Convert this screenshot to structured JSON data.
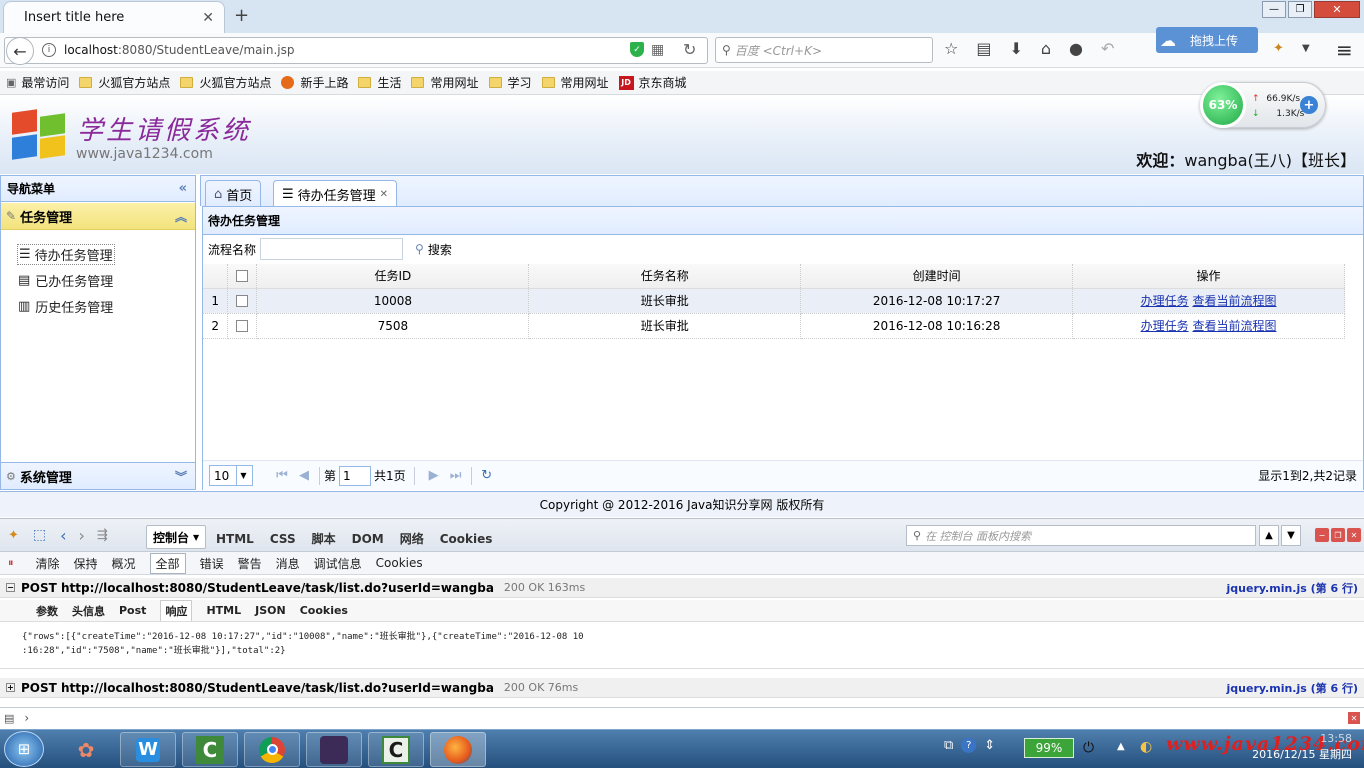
{
  "browser": {
    "tab_title": "Insert title here",
    "url_host": "localhost",
    "url_rest": ":8080/StudentLeave/main.jsp",
    "search_placeholder": "百度 <Ctrl+K>",
    "upload_label": "拖拽上传",
    "bookmarks": [
      "最常访问",
      "火狐官方站点",
      "火狐官方站点",
      "新手上路",
      "生活",
      "常用网址",
      "学习",
      "常用网址",
      "京东商城"
    ]
  },
  "net_widget": {
    "percent": "63%",
    "up": "66.9K/s",
    "down": "1.3K/s"
  },
  "app": {
    "name": "学生请假系统",
    "site": "www.java1234.com",
    "welcome_label": "欢迎：",
    "welcome_user": "wangba(王八)【班长】"
  },
  "sidebar": {
    "title": "导航菜单",
    "section": "任务管理",
    "items": [
      "待办任务管理",
      "已办任务管理",
      "历史任务管理"
    ],
    "system": "系统管理"
  },
  "tabs": {
    "home": "首页",
    "active": "待办任务管理"
  },
  "panel": {
    "title": "待办任务管理",
    "filter_label": "流程名称",
    "search_button": "搜索",
    "columns": [
      "任务ID",
      "任务名称",
      "创建时间",
      "操作"
    ],
    "rows": [
      {
        "num": "1",
        "id": "10008",
        "name": "班长审批",
        "time": "2016-12-08 10:17:27",
        "action1": "办理任务",
        "action2": "查看当前流程图"
      },
      {
        "num": "2",
        "id": "7508",
        "name": "班长审批",
        "time": "2016-12-08 10:16:28",
        "action1": "办理任务",
        "action2": "查看当前流程图"
      }
    ],
    "pager": {
      "page_size": "10",
      "page_prefix": "第",
      "page": "1",
      "page_total": "共1页",
      "summary": "显示1到2,共2记录"
    }
  },
  "copyright": "Copyright @ 2012-2016 Java知识分享网 版权所有",
  "firebug": {
    "tabs": [
      "控制台",
      "HTML",
      "CSS",
      "脚本",
      "DOM",
      "网络",
      "Cookies"
    ],
    "search_placeholder": "在 控制台 面板内搜索",
    "sub": [
      "清除",
      "保持",
      "概况",
      "全部",
      "错误",
      "警告",
      "消息",
      "调试信息",
      "Cookies"
    ],
    "requests": [
      {
        "text": "POST http://localhost:8080/StudentLeave/task/list.do?userId=wangba",
        "status": "200 OK 163ms",
        "source": "jquery.min.js (第 6 行)"
      },
      {
        "text": "POST http://localhost:8080/StudentLeave/task/list.do?userId=wangba",
        "status": "200 OK 76ms",
        "source": "jquery.min.js (第 6 行)"
      }
    ],
    "req_tabs": [
      "参数",
      "头信息",
      "Post",
      "响应",
      "HTML",
      "JSON",
      "Cookies"
    ],
    "response_line1": "{\"rows\":[{\"createTime\":\"2016-12-08 10:17:27\",\"id\":\"10008\",\"name\":\"班长审批\"},{\"createTime\":\"2016-12-08 10",
    "response_line2": ":16:28\",\"id\":\"7508\",\"name\":\"班长审批\"}],\"total\":2}"
  },
  "taskbar": {
    "battery": "99%",
    "clock_time": "13:58",
    "clock_date": "2016/12/15 星期四",
    "watermark": "www.java1234.com"
  }
}
